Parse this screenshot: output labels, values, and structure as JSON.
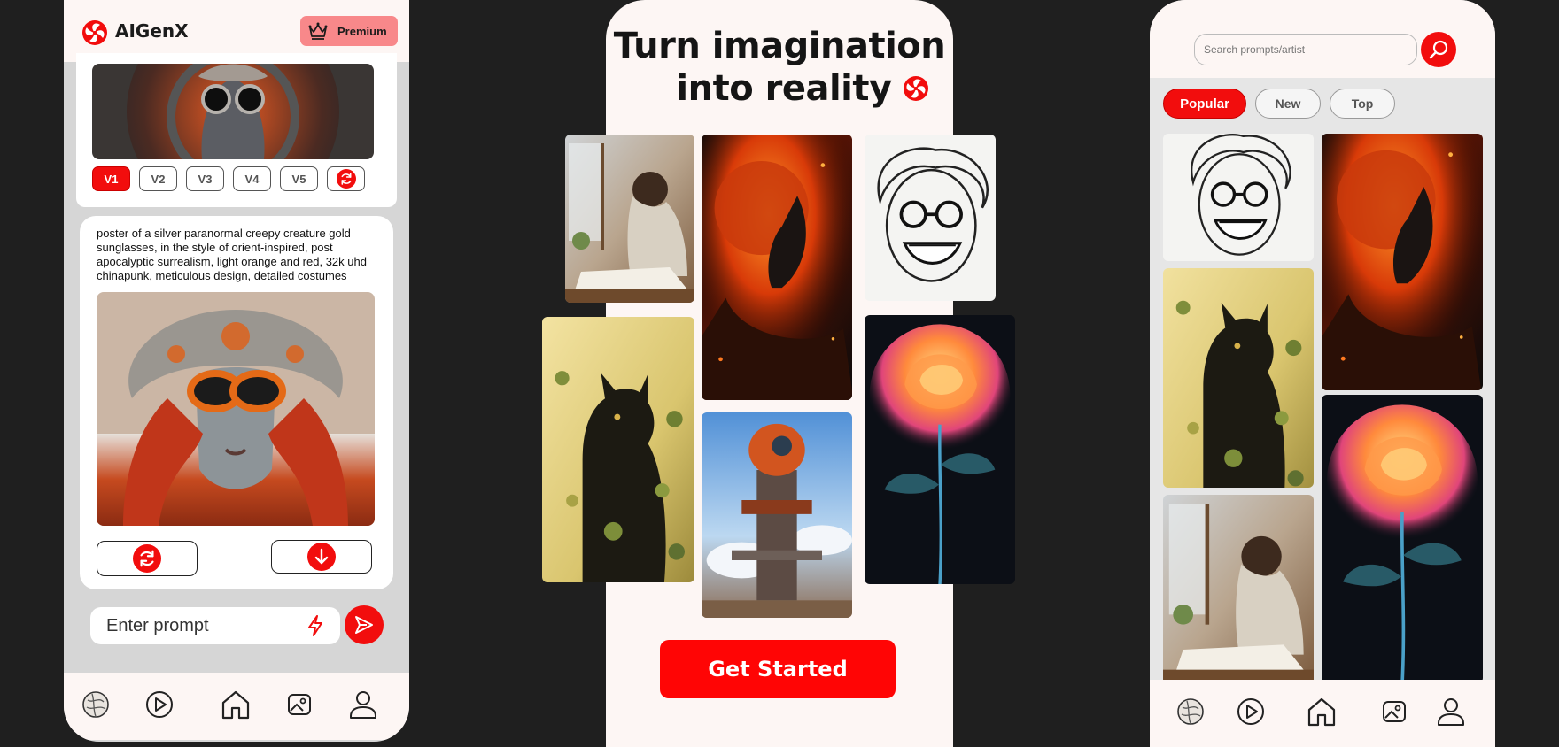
{
  "colors": {
    "accent": "#f20d0d",
    "premium_bg": "#f8888a",
    "background": "#1f1f1f",
    "card": "#fdf6f4"
  },
  "app": {
    "name": "AIGenX",
    "logo_icon": "pinwheel-logo-icon"
  },
  "phone1": {
    "premium_label": "Premium",
    "variant_buttons": [
      "V1",
      "V2",
      "V3",
      "V4",
      "V5"
    ],
    "selected_variant": "V1",
    "prompt_text": "poster of a silver paranormal creepy creature gold sunglasses, in the style of orient-inspired, post apocalyptic surrealism, light orange and red, 32k uhd chinapunk, meticulous design, detailed costumes",
    "prompt_placeholder": "Enter prompt",
    "actions": [
      "regenerate-icon",
      "download-icon"
    ]
  },
  "phone2": {
    "headline_line1": "Turn imagination",
    "headline_line2": "into reality",
    "cta_label": "Get Started",
    "gallery": [
      "woman writing by window",
      "astronaut in flames",
      "smiling old man sketch",
      "black cat among leaves",
      "robot tower in sky",
      "glowing rose"
    ]
  },
  "phone3": {
    "search_placeholder": "Search prompts/artist",
    "filters": [
      "Popular",
      "New",
      "Top"
    ],
    "active_filter": "Popular",
    "feed": [
      "smiling old man sketch",
      "astronaut in flames",
      "black cat among leaves",
      "glowing rose",
      "woman writing by window"
    ]
  },
  "bottom_nav": [
    "explore-globe-icon",
    "play-icon",
    "home-icon",
    "gallery-icon",
    "profile-icon"
  ]
}
